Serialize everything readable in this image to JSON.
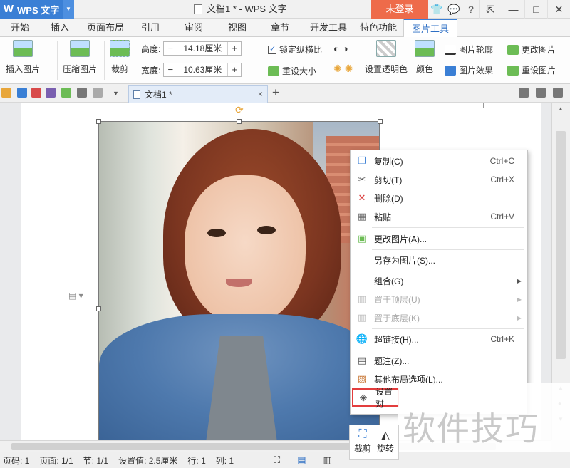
{
  "window": {
    "app_name": "WPS 文字",
    "title": "文档1 * - WPS 文字",
    "login_label": "未登录",
    "icons": [
      "shirt-icon",
      "chat-icon",
      "help-icon",
      "menu-icon"
    ]
  },
  "ribbon_tabs": [
    "开始",
    "插入",
    "页面布局",
    "引用",
    "审阅",
    "视图",
    "章节",
    "开发工具",
    "特色功能",
    "图片工具"
  ],
  "active_tab": "图片工具",
  "ribbon": {
    "insert_picture": "插入图片",
    "compress_picture": "压缩图片",
    "crop": "裁剪",
    "height_label": "高度:",
    "height_value": "14.18厘米",
    "width_label": "宽度:",
    "width_value": "10.63厘米",
    "minus": "−",
    "plus": "+",
    "lock_ratio": "锁定纵横比",
    "reset_size": "重设大小",
    "set_transparent": "设置透明色",
    "color": "颜色",
    "picture_outline": "图片轮廓",
    "picture_effect": "图片效果",
    "change_picture": "更改图片",
    "reset_picture": "重设图片"
  },
  "doc_tab": {
    "name": "文档1 *",
    "close": "×",
    "add": "+"
  },
  "context_menu": {
    "items": [
      {
        "label": "复制(C)",
        "shortcut": "Ctrl+C",
        "icon": "copy-icon"
      },
      {
        "label": "剪切(T)",
        "shortcut": "Ctrl+X",
        "icon": "cut-icon"
      },
      {
        "label": "删除(D)",
        "shortcut": "",
        "icon": "delete-icon"
      },
      {
        "label": "粘贴",
        "shortcut": "Ctrl+V",
        "icon": "paste-icon"
      },
      {
        "label": "更改图片(A)...",
        "shortcut": "",
        "icon": "change-picture-icon"
      },
      {
        "label": "另存为图片(S)...",
        "shortcut": "",
        "icon": ""
      },
      {
        "label": "组合(G)",
        "shortcut": "",
        "icon": ""
      },
      {
        "label": "置于顶层(U)",
        "shortcut": "",
        "icon": "bring-front-icon"
      },
      {
        "label": "置于底层(K)",
        "shortcut": "",
        "icon": "send-back-icon"
      },
      {
        "label": "超链接(H)...",
        "shortcut": "Ctrl+K",
        "icon": "hyperlink-icon"
      },
      {
        "label": "题注(Z)...",
        "shortcut": "",
        "icon": "caption-icon"
      },
      {
        "label": "其他布局选项(L)...",
        "shortcut": "",
        "icon": "layout-options-icon"
      },
      {
        "label": "设置对",
        "shortcut": "",
        "icon": "format-object-icon"
      }
    ]
  },
  "mini_toolbar": {
    "crop": "裁剪",
    "rotate": "旋转"
  },
  "statusbar": {
    "page_code": "页码: 1",
    "page": "页面: 1/1",
    "section": "节: 1/1",
    "setting": "设置值: 2.5厘米",
    "row": "行: 1",
    "col": "列: 1"
  },
  "watermark": "软件技巧"
}
